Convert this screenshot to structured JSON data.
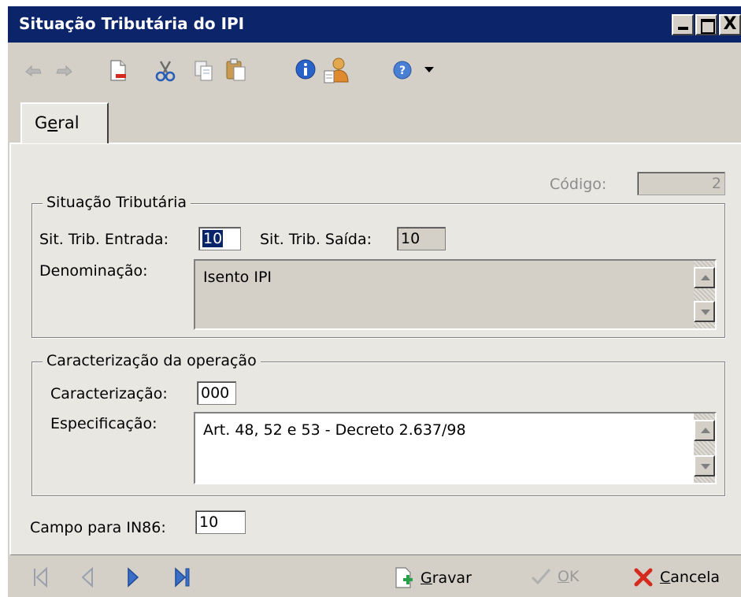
{
  "window": {
    "title": "Situação Tributária do IPI"
  },
  "caption_buttons": {
    "close_glyph": "X"
  },
  "toolbar": {
    "icons": [
      "undo-icon",
      "redo-icon",
      "new-document-icon",
      "cut-icon",
      "copy-icon",
      "paste-icon",
      "info-icon",
      "user-icon",
      "help-icon",
      "dropdown-arrow-icon"
    ]
  },
  "tab": {
    "label_pre": "G",
    "label_ul": "e",
    "label_post": "ral"
  },
  "codigo": {
    "label": "Código:",
    "value": "2"
  },
  "situacao_tributaria": {
    "group_title": "Situação Tributária",
    "entrada_label": "Sit. Trib. Entrada:",
    "entrada_value": "10",
    "saida_label": "Sit. Trib. Saída:",
    "saida_value": "10",
    "denominacao_label": "Denominação:",
    "denominacao_value": "Isento IPI"
  },
  "caracterizacao_operacao": {
    "group_title": "Caracterização da operação",
    "caracterizacao_label": "Caracterização:",
    "caracterizacao_value": "000",
    "especificacao_label": "Especificação:",
    "especificacao_value": "Art. 48, 52  e 53 - Decreto 2.637/98"
  },
  "in86": {
    "label": "Campo para IN86:",
    "value": "10"
  },
  "bottom": {
    "gravar_ul": "G",
    "gravar_rest": "ravar",
    "ok_ul": "O",
    "ok_rest": "K",
    "cancela_ul": "C",
    "cancela_rest": "ancela"
  },
  "colors": {
    "titlebar": "#0b246a",
    "panel": "#e9e7e2",
    "chrome": "#d4d0c8",
    "selection": "#0a246a",
    "nav_active": "#3a6fc8",
    "cancel_red": "#d42b1e"
  }
}
